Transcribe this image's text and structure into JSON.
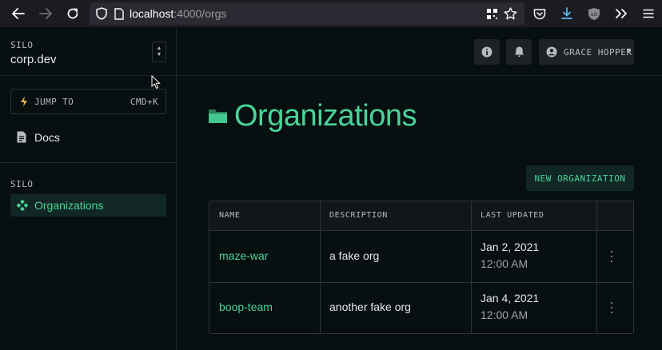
{
  "browser": {
    "url_host": "localhost",
    "url_path": ":4000/orgs"
  },
  "sidebar": {
    "silo_label": "SILO",
    "silo_name": "corp.dev",
    "jump_to_label": "JUMP TO",
    "jump_to_shortcut": "CMD+K",
    "docs_label": "Docs",
    "section_label": "SILO",
    "organizations_label": "Organizations"
  },
  "topbar": {
    "user_name": "GRACE HOPPER"
  },
  "page": {
    "title": "Organizations",
    "new_button_label": "NEW ORGANIZATION"
  },
  "table": {
    "headers": [
      "NAME",
      "DESCRIPTION",
      "LAST UPDATED"
    ],
    "rows": [
      {
        "name": "maze-war",
        "description": "a fake org",
        "date": "Jan 2, 2021",
        "time": "12:00 AM"
      },
      {
        "name": "boop-team",
        "description": "another fake org",
        "date": "Jan 4, 2021",
        "time": "12:00 AM"
      }
    ]
  },
  "colors": {
    "accent": "#48d597",
    "background": "#080f11",
    "accent_bg": "#112725"
  }
}
